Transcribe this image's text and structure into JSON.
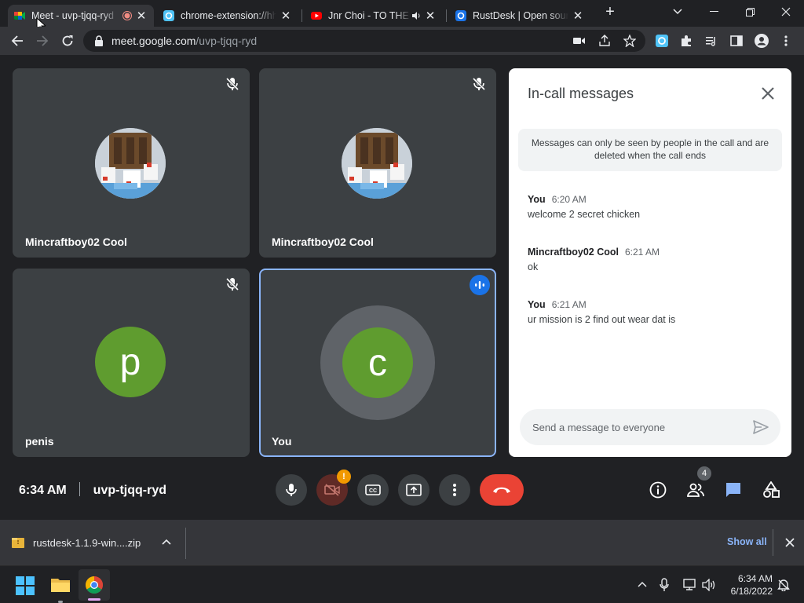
{
  "browser": {
    "tabs": [
      {
        "title": "Meet - uvp-tjqq-ryd",
        "active": true,
        "favicon": "google-meet-icon"
      },
      {
        "title": "chrome-extension://hhdhk",
        "active": false,
        "favicon": "extension-icon"
      },
      {
        "title": "Jnr Choi - TO THE MOON",
        "active": false,
        "favicon": "youtube-icon"
      },
      {
        "title": "RustDesk | Open source",
        "active": false,
        "favicon": "rustdesk-icon"
      }
    ],
    "url_host": "meet.google.com",
    "url_path": "/uvp-tjqq-ryd"
  },
  "tiles": [
    {
      "name": "Mincraftboy02 Cool"
    },
    {
      "name": "Mincraftboy02 Cool"
    },
    {
      "name": "penis",
      "initial": "p"
    },
    {
      "name": "You",
      "initial": "c"
    }
  ],
  "chat": {
    "title": "In-call messages",
    "notice": "Messages can only be seen by people in the call and are deleted when the call ends",
    "messages": [
      {
        "sender": "You",
        "time": "6:20 AM",
        "text": "welcome 2 secret chicken"
      },
      {
        "sender": "Mincraftboy02 Cool",
        "time": "6:21 AM",
        "text": "ok"
      },
      {
        "sender": "You",
        "time": "6:21 AM",
        "text": "ur mission is 2 find out wear dat is"
      }
    ],
    "input_placeholder": "Send a message to everyone"
  },
  "controls": {
    "time": "6:34 AM",
    "meeting_code": "uvp-tjqq-ryd",
    "camera_alert": "!",
    "people_count": "4"
  },
  "downloads": {
    "file": "rustdesk-1.1.9-win....zip",
    "show_all": "Show all"
  },
  "taskbar": {
    "time": "6:34 AM",
    "date": "6/18/2022"
  },
  "colors": {
    "meet_blue": "#8ab4f8",
    "end_call_red": "#ea4335",
    "avatar_green": "#5f9c2f",
    "tile_bg": "#3c4043"
  }
}
